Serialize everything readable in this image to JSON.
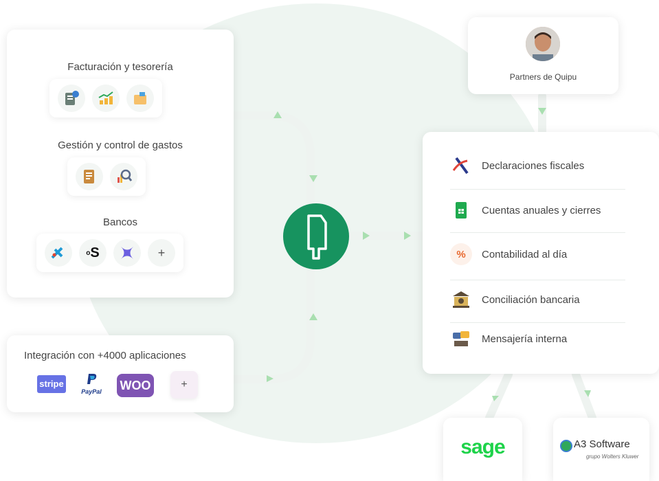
{
  "left": {
    "billing_title": "Facturación y tesorería",
    "expenses_title": "Gestión y control de gastos",
    "banks_title": "Bancos",
    "banks_more": "+"
  },
  "integrations": {
    "title": "Integración con +4000 aplicaciones",
    "stripe": "stripe",
    "paypal": "PayPal",
    "woo": "WOO",
    "more": "+"
  },
  "partners": {
    "label": "Partners de Quipu"
  },
  "services": [
    {
      "label": "Declaraciones fiscales",
      "icon": "tax-icon"
    },
    {
      "label": "Cuentas anuales y cierres",
      "icon": "spreadsheet-icon"
    },
    {
      "label": "Contabilidad al día",
      "icon": "percent-icon"
    },
    {
      "label": "Conciliación bancaria",
      "icon": "bank-icon"
    },
    {
      "label": "Mensajería interna",
      "icon": "chat-icon"
    }
  ],
  "exports": {
    "sage": "sage",
    "a3_title": "A3 Software",
    "a3_sub": "grupo Wolters Kluwer"
  },
  "colors": {
    "brand": "#17935f",
    "sage": "#1ed34a",
    "woo": "#7f54b3",
    "stripe": "#6772e5"
  }
}
